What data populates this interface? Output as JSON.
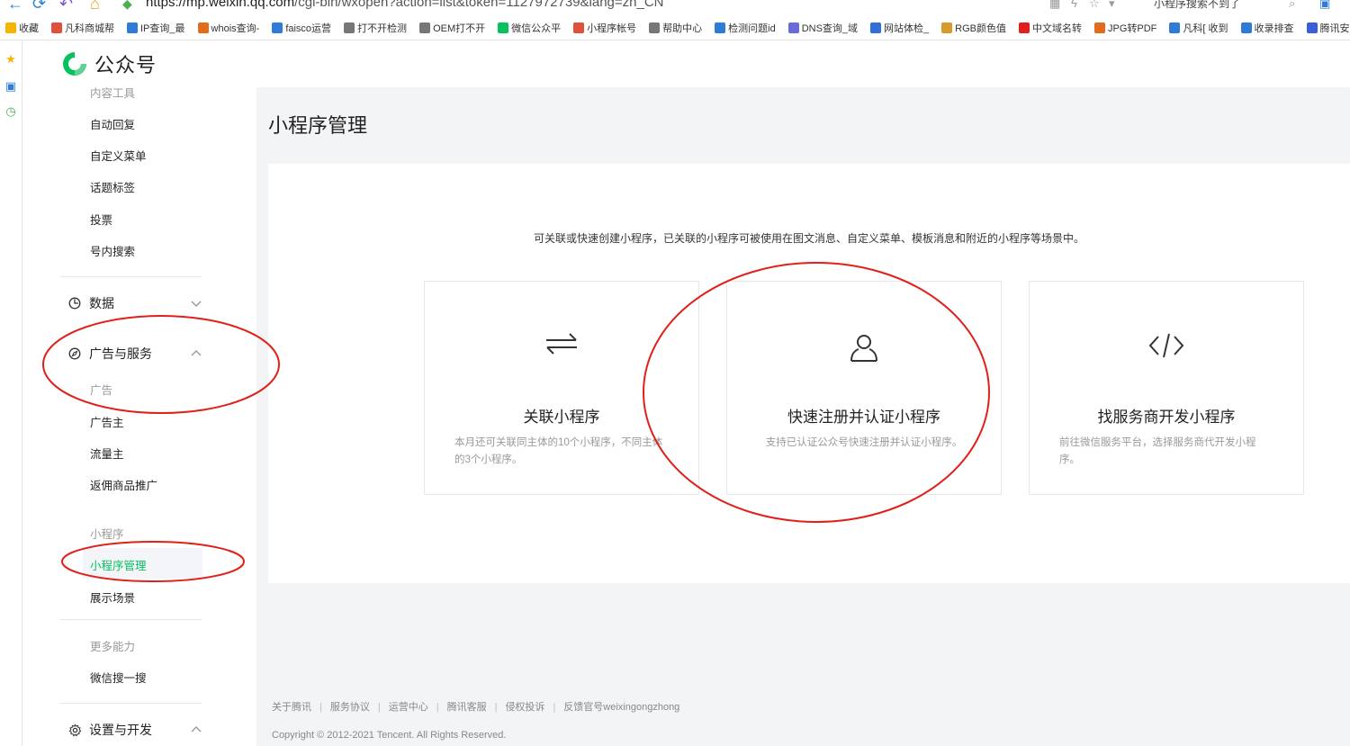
{
  "browser": {
    "url_host": "https://mp.weixin.qq.com",
    "url_path": "/cgi-bin/wxopen?action=list&token=1127972739&lang=zh_CN",
    "tab_title": "小程序搜索不到了"
  },
  "bookmarks": [
    {
      "label": "收藏",
      "icon": "star-icon",
      "color": "#f5b400"
    },
    {
      "label": "凡科商城帮",
      "icon": "fanke-icon",
      "color": "#e0513b"
    },
    {
      "label": "IP查询_最",
      "icon": "ip-icon",
      "color": "#2f7bd6"
    },
    {
      "label": "whois查询-",
      "icon": "whois-icon",
      "color": "#e06d1d"
    },
    {
      "label": "faisco运营",
      "icon": "faisco-icon",
      "color": "#2f7bd6"
    },
    {
      "label": "打不开检测",
      "icon": "doc-icon",
      "color": "#777777"
    },
    {
      "label": "OEM打不开",
      "icon": "doc-icon",
      "color": "#777777"
    },
    {
      "label": "微信公众平",
      "icon": "wechat-icon",
      "color": "#07c160"
    },
    {
      "label": "小程序帐号",
      "icon": "fanke-icon",
      "color": "#e0513b"
    },
    {
      "label": "帮助中心",
      "icon": "doc-icon",
      "color": "#777777"
    },
    {
      "label": "检测问题id",
      "icon": "faisco-icon",
      "color": "#2f7bd6"
    },
    {
      "label": "DNS查询_域",
      "icon": "dns-icon",
      "color": "#6b6bd8"
    },
    {
      "label": "网站体检_",
      "icon": "paw-icon",
      "color": "#2f6fd6"
    },
    {
      "label": "RGB颜色值",
      "icon": "rainbow-icon",
      "color": "#d69a2f"
    },
    {
      "label": "中文域名转",
      "icon": "x-icon",
      "color": "#e02020"
    },
    {
      "label": "JPG转PDF",
      "icon": "pdf-icon",
      "color": "#e06d1d"
    },
    {
      "label": "凡科[ 收到",
      "icon": "faisco-icon",
      "color": "#2f7bd6"
    },
    {
      "label": "收录排查",
      "icon": "faisco-icon",
      "color": "#2f7bd6"
    },
    {
      "label": "腾讯安",
      "icon": "tencent-icon",
      "color": "#3b5fd6"
    }
  ],
  "header": {
    "logo_text": "公众号"
  },
  "sidebar": {
    "top_cut_label": "内容工具",
    "content_items": [
      "自动回复",
      "自定义菜单",
      "话题标签",
      "投票",
      "号内搜索"
    ],
    "data_label": "数据",
    "ads_label": "广告与服务",
    "ads_group_label": "广告",
    "ads_items": [
      "广告主",
      "流量主",
      "返佣商品推广"
    ],
    "mini_group_label": "小程序",
    "mini_items": [
      "小程序管理",
      "展示场景"
    ],
    "more_group_label": "更多能力",
    "more_items": [
      "微信搜一搜"
    ],
    "settings_label": "设置与开发"
  },
  "main": {
    "title": "小程序管理",
    "intro": "可关联或快速创建小程序，已关联的小程序可被使用在图文消息、自定义菜单、模板消息和附近的小程序等场景中。",
    "cards": [
      {
        "title": "关联小程序",
        "desc": "本月还可关联同主体的10个小程序，不同主体的3个小程序。",
        "icon": "link-arrows-icon"
      },
      {
        "title": "快速注册并认证小程序",
        "desc": "支持已认证公众号快速注册并认证小程序。",
        "icon": "user-icon"
      },
      {
        "title": "找服务商开发小程序",
        "desc": "前往微信服务平台，选择服务商代开发小程序。",
        "icon": "code-icon"
      }
    ]
  },
  "footer": {
    "links": [
      "关于腾讯",
      "服务协议",
      "运营中心",
      "腾讯客服",
      "侵权投诉",
      "反馈官号weixingongzhong"
    ],
    "copyright": "Copyright © 2012-2021 Tencent. All Rights Reserved."
  },
  "colors": {
    "accent": "#07c160",
    "annotation": "#e0201b"
  }
}
